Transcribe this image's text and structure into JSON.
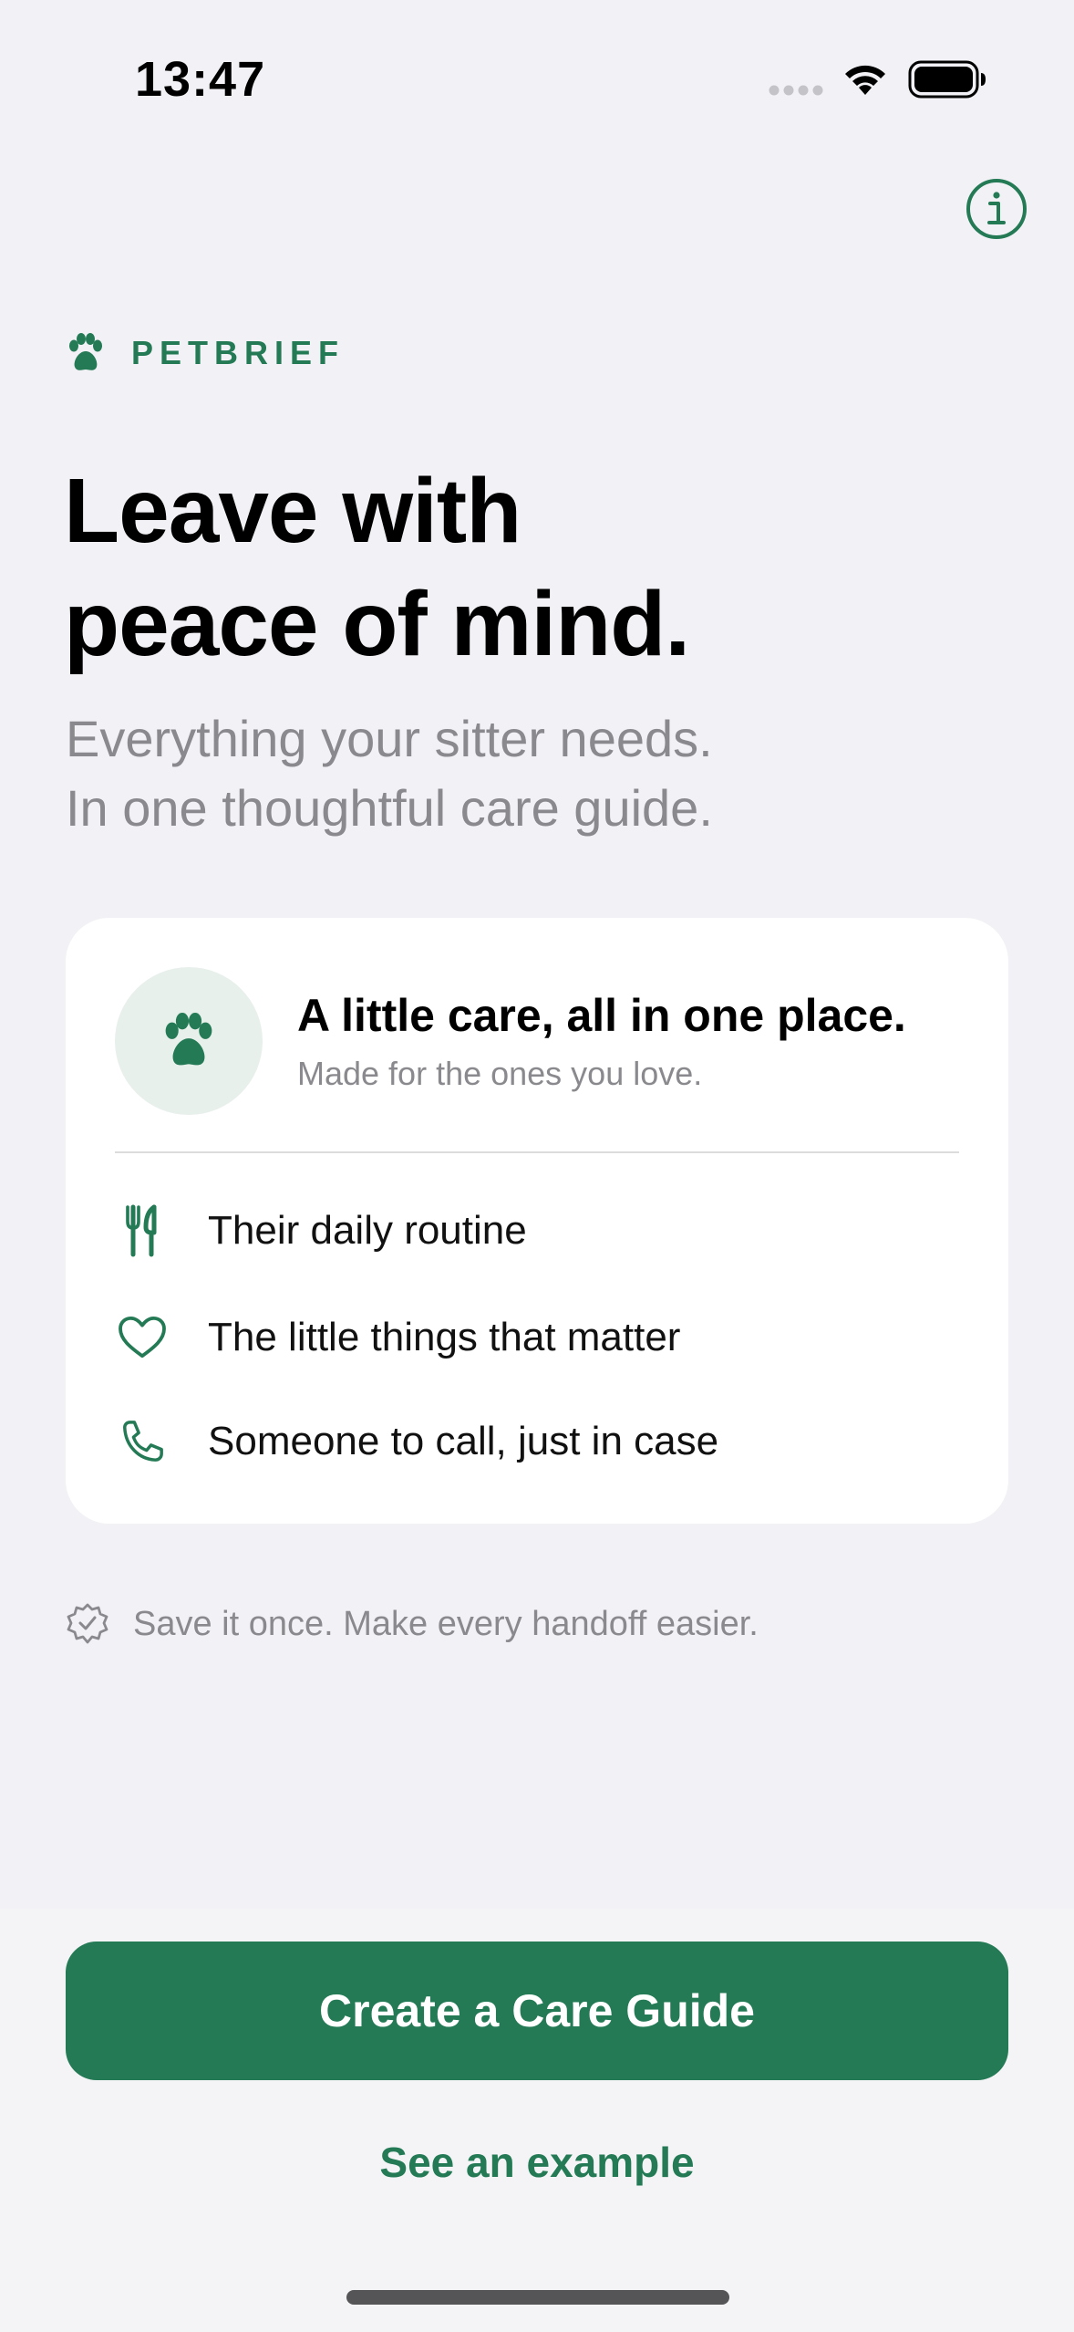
{
  "status_bar": {
    "time": "13:47"
  },
  "icons": {
    "info": "info-circle-icon",
    "brand": "paw-icon",
    "avatar": "paw-icon",
    "feature_1": "fork-knife-icon",
    "feature_2": "heart-icon",
    "feature_3": "phone-icon",
    "footnote": "checkmark-seal-icon"
  },
  "brand": {
    "name": "PETBRIEF"
  },
  "hero": {
    "headline_line1": "Leave with",
    "headline_line2": "peace of mind.",
    "subheadline_line1": "Everything your sitter needs.",
    "subheadline_line2": "In one thoughtful care guide."
  },
  "card": {
    "title": "A little care, all in one place.",
    "subtitle": "Made for the ones you love.",
    "features": [
      {
        "label": "Their daily routine",
        "icon": "fork-knife-icon"
      },
      {
        "label": "The little things that matter",
        "icon": "heart-icon"
      },
      {
        "label": "Someone to call, just in case",
        "icon": "phone-icon"
      }
    ]
  },
  "footnote": {
    "text": "Save it once. Make every handoff easier."
  },
  "actions": {
    "primary_label": "Create a Care Guide",
    "secondary_label": "See an example"
  },
  "colors": {
    "accent": "#237a55",
    "background": "#f2f2f6",
    "card": "#ffffff",
    "secondary_text": "#8a8a8e",
    "avatar_bg": "#e8f0ec"
  }
}
